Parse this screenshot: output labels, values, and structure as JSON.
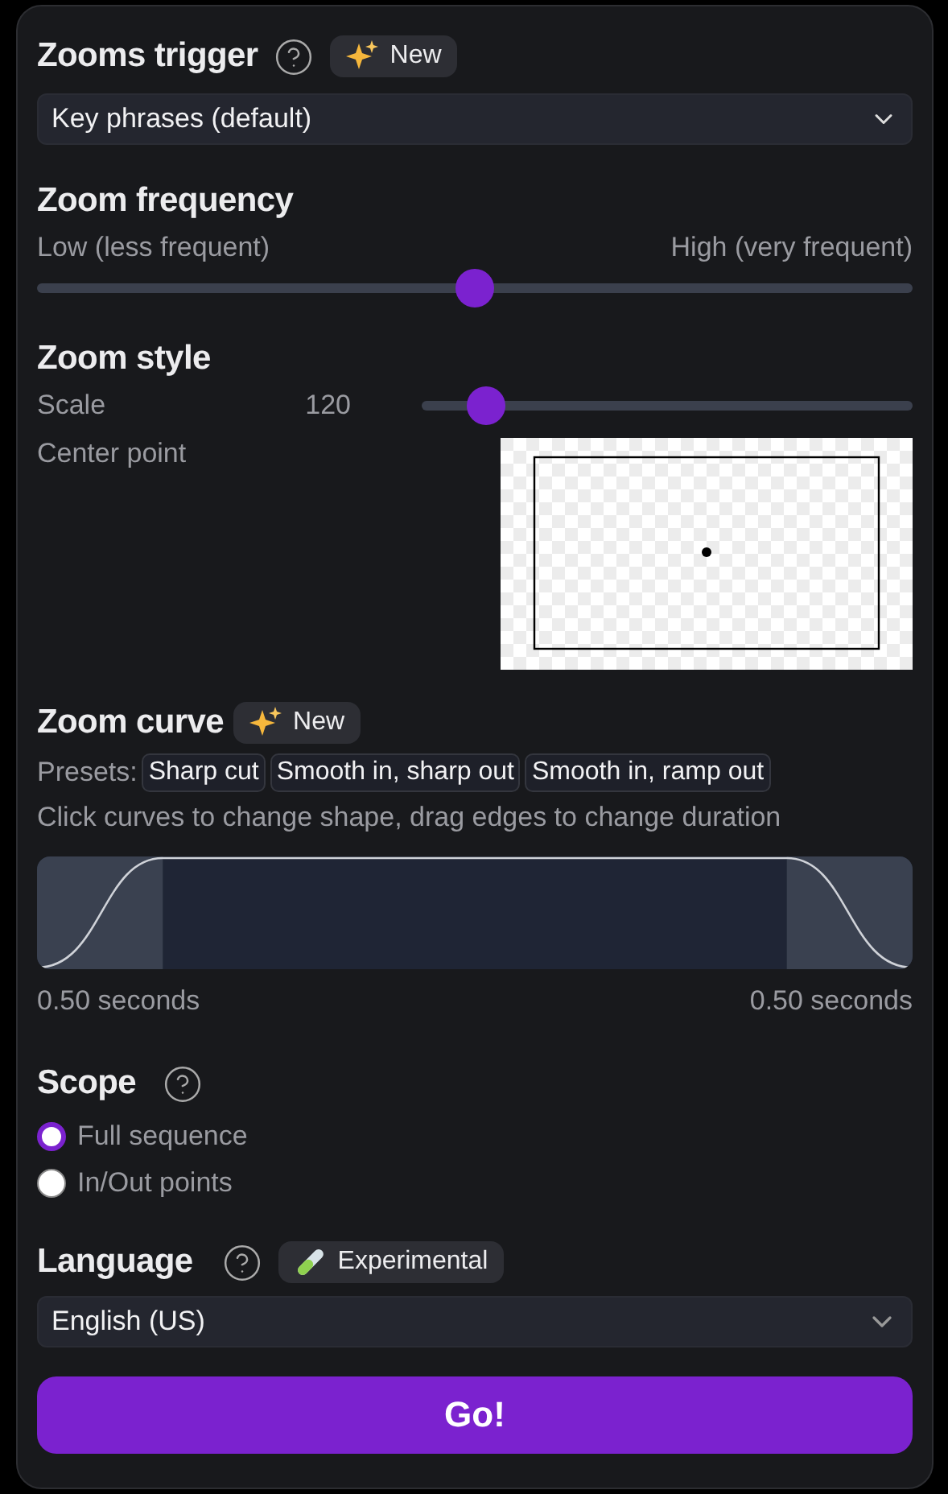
{
  "trigger": {
    "title": "Zooms trigger",
    "badge": "New",
    "select_value": "Key phrases (default)"
  },
  "frequency": {
    "title": "Zoom frequency",
    "low_label": "Low (less frequent)",
    "high_label": "High (very frequent)",
    "level": 0.5
  },
  "style": {
    "title": "Zoom style",
    "scale_label": "Scale",
    "scale_value": "120",
    "scale_slider": {
      "level": 0.13
    },
    "center_label": "Center point"
  },
  "curve": {
    "title": "Zoom curve",
    "badge": "New",
    "presets_label": "Presets:",
    "presets": [
      "Sharp cut",
      "Smooth in, sharp out",
      "Smooth in, ramp out"
    ],
    "hint": "Click curves to change shape, drag edges to change duration",
    "in_duration": "0.50 seconds",
    "out_duration": "0.50 seconds"
  },
  "scope": {
    "title": "Scope",
    "options": [
      {
        "label": "Full sequence",
        "selected": true
      },
      {
        "label": "In/Out points",
        "selected": false
      }
    ]
  },
  "language": {
    "title": "Language",
    "badge": "Experimental",
    "select_value": "English (US)"
  },
  "go_button": "Go!"
}
